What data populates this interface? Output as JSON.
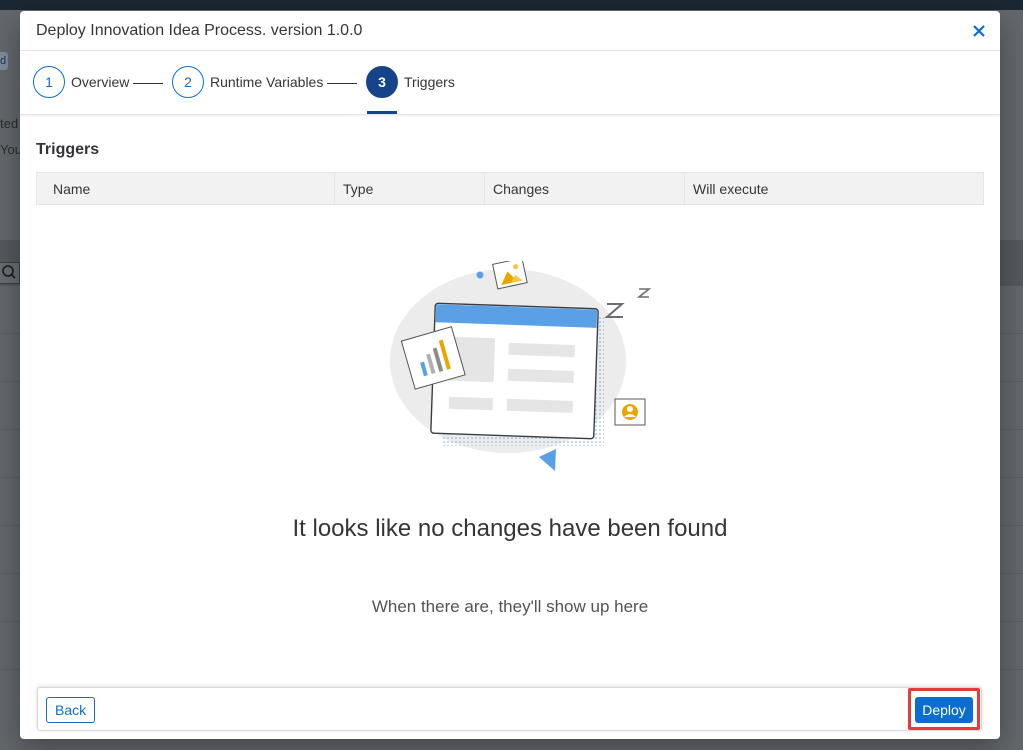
{
  "background": {
    "fragments": [
      "d",
      "ted",
      "You"
    ]
  },
  "dialog": {
    "title": "Deploy Innovation Idea Process. version 1.0.0",
    "close_icon": "close-icon"
  },
  "wizard": {
    "steps": [
      {
        "number": "1",
        "label": "Overview",
        "state": "completed"
      },
      {
        "number": "2",
        "label": "Runtime Variables",
        "state": "completed"
      },
      {
        "number": "3",
        "label": "Triggers",
        "state": "active"
      }
    ]
  },
  "triggers": {
    "title": "Triggers",
    "columns": [
      "Name",
      "Type",
      "Changes",
      "Will execute"
    ]
  },
  "empty_state": {
    "title": "It looks like no changes have been found",
    "subtitle": "When there are, they'll show up here"
  },
  "footer": {
    "back_label": "Back",
    "deploy_label": "Deploy"
  },
  "colors": {
    "accent": "#0a6ed1",
    "active_step": "#16448a",
    "highlight": "#e53b3b"
  }
}
